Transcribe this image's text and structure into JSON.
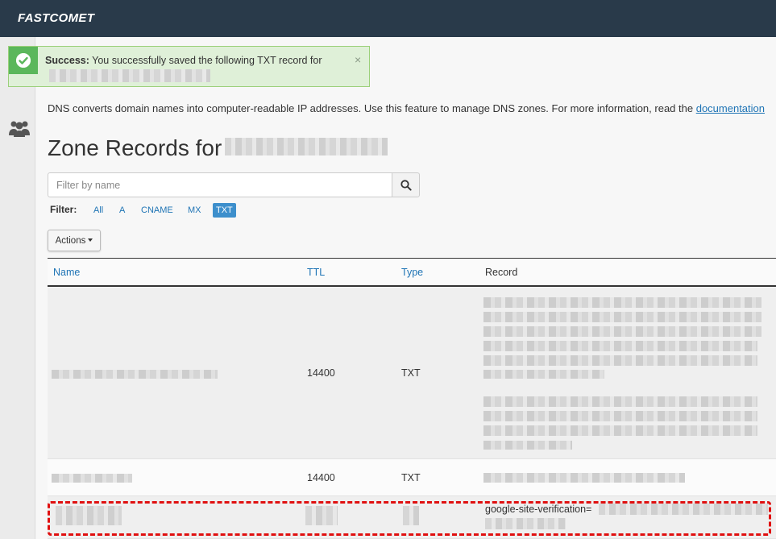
{
  "header": {
    "brand": "FASTCOMET"
  },
  "alert": {
    "strong": "Success:",
    "message": "You successfully saved the following TXT record for",
    "close": "×"
  },
  "description": {
    "text": "DNS converts domain names into computer-readable IP addresses. Use this feature to manage DNS zones. For more information, read the ",
    "link": "documentation"
  },
  "zone": {
    "title": "Zone Records for"
  },
  "search": {
    "placeholder": "Filter by name"
  },
  "filter": {
    "label": "Filter:",
    "options": [
      "All",
      "A",
      "CNAME",
      "MX",
      "TXT"
    ],
    "active": "TXT"
  },
  "actions": {
    "label": "Actions"
  },
  "table": {
    "headers": {
      "name": "Name",
      "ttl": "TTL",
      "type": "Type",
      "record": "Record"
    },
    "rows": [
      {
        "ttl": "14400",
        "type": "TXT",
        "record": ""
      },
      {
        "ttl": "14400",
        "type": "TXT",
        "record": ""
      },
      {
        "ttl": "",
        "type": "",
        "record": "google-site-verification="
      }
    ]
  },
  "colors": {
    "topbar": "#293a4a",
    "success": "#5bb75b",
    "link": "#1f74b5",
    "highlight": "#e01010"
  }
}
